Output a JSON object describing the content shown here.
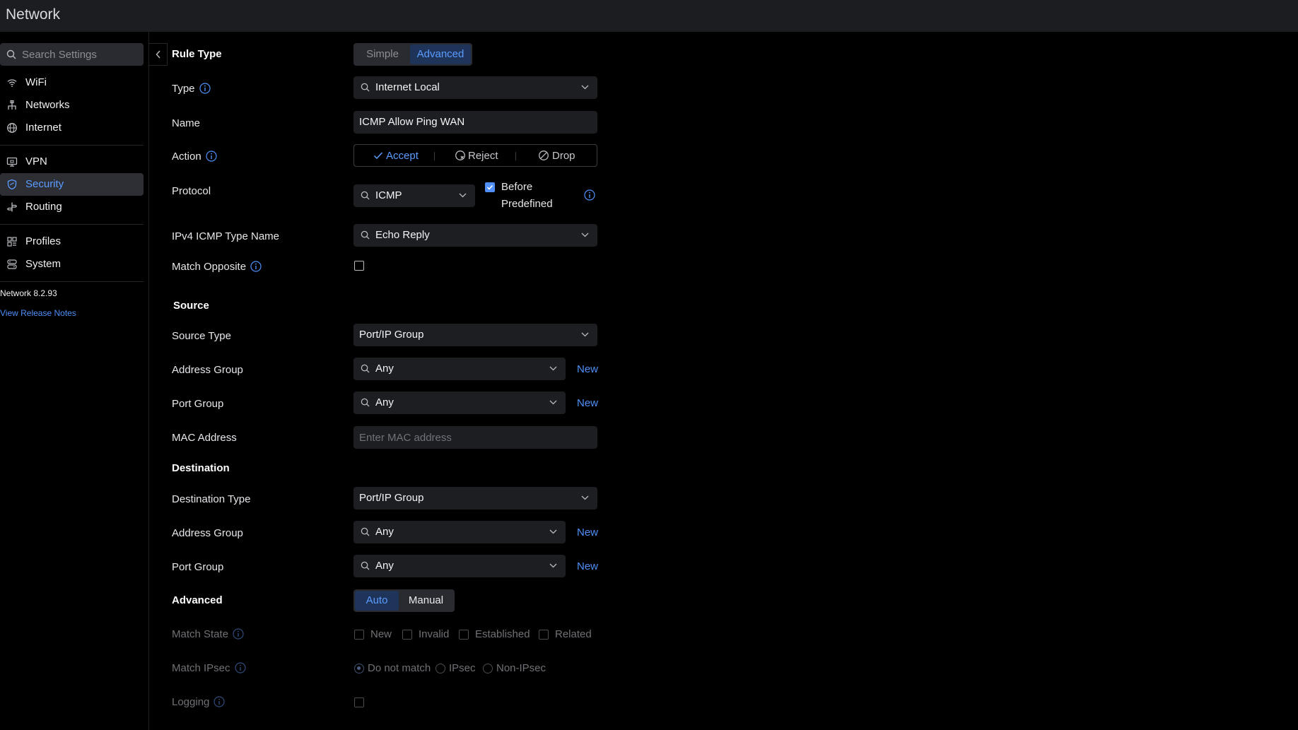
{
  "app": {
    "title": "Network"
  },
  "sidebar": {
    "search_placeholder": "Search Settings",
    "items": [
      {
        "label": "WiFi",
        "icon": "wifi-icon"
      },
      {
        "label": "Networks",
        "icon": "networks-icon"
      },
      {
        "label": "Internet",
        "icon": "globe-icon"
      },
      {
        "label": "VPN",
        "icon": "vpn-icon"
      },
      {
        "label": "Security",
        "icon": "shield-icon",
        "active": true
      },
      {
        "label": "Routing",
        "icon": "routing-icon"
      },
      {
        "label": "Profiles",
        "icon": "profiles-icon"
      },
      {
        "label": "System",
        "icon": "system-icon"
      }
    ],
    "version": "Network 8.2.93",
    "release_notes": "View Release Notes"
  },
  "form": {
    "rule_type": {
      "label": "Rule Type",
      "options": [
        "Simple",
        "Advanced"
      ],
      "selected": "Advanced"
    },
    "type": {
      "label": "Type",
      "value": "Internet Local"
    },
    "name": {
      "label": "Name",
      "value": "ICMP Allow Ping WAN"
    },
    "action": {
      "label": "Action",
      "options": [
        "Accept",
        "Reject",
        "Drop"
      ],
      "selected": "Accept"
    },
    "protocol": {
      "label": "Protocol",
      "value": "ICMP",
      "before_predefined_line1": "Before",
      "before_predefined_line2": "Predefined",
      "before_predefined_checked": true
    },
    "icmp_type": {
      "label": "IPv4 ICMP Type Name",
      "value": "Echo Reply"
    },
    "match_opposite": {
      "label": "Match Opposite",
      "checked": false
    },
    "source": {
      "heading": "Source",
      "type_label": "Source Type",
      "type_value": "Port/IP Group",
      "address_group_label": "Address Group",
      "address_group_value": "Any",
      "port_group_label": "Port Group",
      "port_group_value": "Any",
      "mac_label": "MAC Address",
      "mac_placeholder": "Enter MAC address",
      "new_label": "New"
    },
    "destination": {
      "heading": "Destination",
      "type_label": "Destination Type",
      "type_value": "Port/IP Group",
      "address_group_label": "Address Group",
      "address_group_value": "Any",
      "port_group_label": "Port Group",
      "port_group_value": "Any",
      "new_label": "New"
    },
    "advanced": {
      "heading": "Advanced",
      "options": [
        "Auto",
        "Manual"
      ],
      "selected": "Auto",
      "match_state_label": "Match State",
      "match_state_options": [
        "New",
        "Invalid",
        "Established",
        "Related"
      ],
      "match_ipsec_label": "Match IPsec",
      "match_ipsec_options": [
        "Do not match",
        "IPsec",
        "Non-IPsec"
      ],
      "match_ipsec_selected": "Do not match",
      "logging_label": "Logging"
    }
  },
  "colors": {
    "accent": "#4f8ff7",
    "topbar": "#1c1d21",
    "field_bg": "#1d1e22",
    "active_nav_bg": "#2e2f35"
  }
}
